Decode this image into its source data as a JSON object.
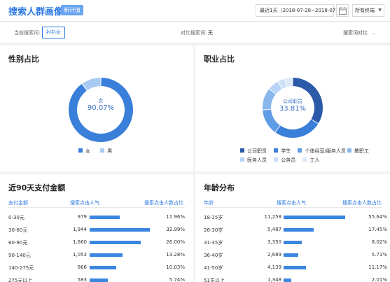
{
  "header": {
    "title": "搜索人群画像",
    "beta_badge": "新计值",
    "date_range": "最近1天（2018-07-28~2018-07-28）",
    "terminal": "所有终端"
  },
  "keyword_bar": {
    "current_label": "当前搜索词:",
    "current_value": "衬衫女",
    "compare_label": "对比搜索词:",
    "compare_value": "无",
    "compare_button": "搜索词对比"
  },
  "colors": {
    "accent": "#2b78e4",
    "female": "#3a7fd9",
    "male": "#a9cbf3",
    "bar": "#3b86e0"
  },
  "gender": {
    "title": "性别占比",
    "center_label": "女",
    "center_value": "90.07%",
    "legend": [
      "女",
      "男"
    ]
  },
  "job": {
    "title": "职业占比",
    "center_label": "公司职员",
    "center_value": "33.81%",
    "legend": [
      "公司职员",
      "学生",
      "个体经营/服务人员",
      "教职工",
      "医务人员",
      "公务员",
      "工人"
    ]
  },
  "chart_data": [
    {
      "type": "pie",
      "title": "性别占比",
      "categories": [
        "女",
        "男"
      ],
      "values": [
        90.07,
        9.93
      ],
      "colors": [
        "#3a7fd9",
        "#a9cbf3"
      ]
    },
    {
      "type": "pie",
      "title": "职业占比",
      "categories": [
        "公司职员",
        "学生",
        "个体经营/服务人员",
        "教职工",
        "医务人员",
        "公务员",
        "工人"
      ],
      "values": [
        33.81,
        26.0,
        14.0,
        12.0,
        6.0,
        4.0,
        4.19
      ],
      "colors": [
        "#2a5aa8",
        "#3a7fd9",
        "#5f9ce6",
        "#8ab6ee",
        "#b7d3f6",
        "#cde0f8",
        "#dce9f9"
      ]
    },
    {
      "type": "bar",
      "title": "近90天支付金额",
      "columns": [
        "支付金额",
        "搜索点击人气",
        "搜索点击人数占比"
      ],
      "categories": [
        "0-30元",
        "30-60元",
        "60-90元",
        "90-140元",
        "140-275元",
        "275元以上"
      ],
      "values": [
        979,
        1944,
        1660,
        1053,
        866,
        583
      ],
      "labels": [
        "979",
        "1,944",
        "1,660",
        "1,053",
        "866",
        "583"
      ],
      "percents": [
        "11.96%",
        "32.99%",
        "26.00%",
        "13.28%",
        "10.03%",
        "5.74%"
      ]
    },
    {
      "type": "bar",
      "title": "年龄分布",
      "columns": [
        "年龄",
        "搜索点击人气",
        "搜索点击人数占比"
      ],
      "categories": [
        "18-25岁",
        "26-30岁",
        "31-35岁",
        "36-40岁",
        "41-50岁",
        "51岁以上"
      ],
      "values": [
        11258,
        5487,
        3350,
        2689,
        4139,
        1348
      ],
      "labels": [
        "11,258",
        "5,487",
        "3,350",
        "2,689",
        "4,139",
        "1,348"
      ],
      "percents": [
        "55.64%",
        "17.45%",
        "8.02%",
        "5.71%",
        "11.17%",
        "2.01%"
      ]
    }
  ]
}
